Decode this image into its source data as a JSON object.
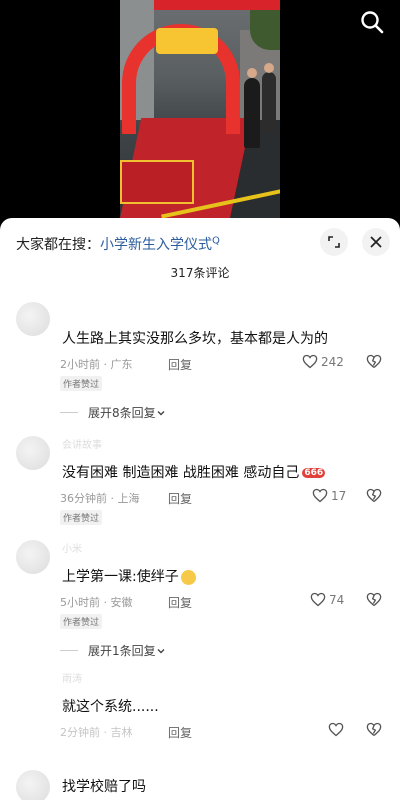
{
  "search_hint": {
    "prefix": "大家都在搜：",
    "query": "小学新生入学仪式",
    "query_icon": "Q"
  },
  "comment_count_label": "317条评论",
  "icons": {
    "search": "search-icon",
    "collapse": "collapse-icon",
    "close": "close-icon",
    "like": "heart-icon",
    "dislike": "broken-heart-icon",
    "expand": "chevron-down-icon"
  },
  "comments": [
    {
      "text": "人生路上其实没那么多坎，基本都是人为的",
      "meta": "2小时前 · 广东",
      "reply_label": "回复",
      "likes": "242",
      "badge": "作者赞过",
      "expand_label": "展开8条回复"
    },
    {
      "username": "会讲故事",
      "text": "没有困难 制造困难 战胜困难 感动自己",
      "emoji": "666",
      "meta": "36分钟前 · 上海",
      "reply_label": "回复",
      "likes": "17",
      "badge": "作者赞过"
    },
    {
      "username": "小米",
      "text": "上学第一课:使绊子",
      "meta": "5小时前 · 安徽",
      "reply_label": "回复",
      "likes": "74",
      "badge": "作者赞过",
      "expand_label": "展开1条回复"
    },
    {
      "username": "雨涛",
      "text": "就这个系统......",
      "meta": "2分钟前 · 吉林",
      "reply_label": "回复",
      "likes": ""
    },
    {
      "text": "找学校赔了吗"
    }
  ]
}
